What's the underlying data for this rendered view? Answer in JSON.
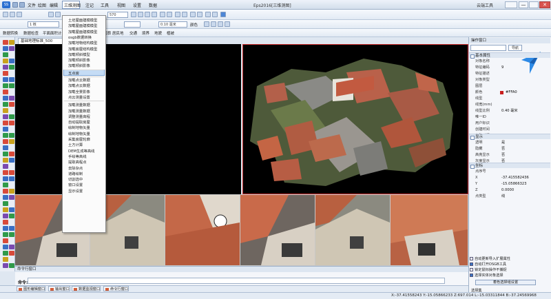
{
  "app": {
    "logo": "SS",
    "title": "Eps2016[三维测图]"
  },
  "menu": [
    "文件",
    "绘图",
    "编辑",
    "三维测图",
    "注记",
    "工具",
    "视图",
    "设置",
    "数据"
  ],
  "window_controls": {
    "help": "帮助",
    "cloud": "云端工具",
    "minimize": "—",
    "close": "✕"
  },
  "toolbar": {
    "layer_value": "1 核",
    "scale_value": "570",
    "line_width": "0.10 毫米",
    "dash_label": "颜色"
  },
  "tabs_row": [
    "数据转换",
    "数据检查",
    "平面面积计算",
    "图廓",
    "居民地",
    "交通",
    "境界",
    "地貌",
    "植被"
  ],
  "document_tab": {
    "label": "基础地理标准_500",
    "close": "×"
  },
  "dropdown": {
    "group1": [
      "土坯屋面建模模型",
      "加载屋面建模模型",
      "加载屋面建模模型",
      "osgb数据转换",
      "加载地物结构模型",
      "加载房屋结构模型",
      "加载倾斜模型",
      "加载倾斜影像",
      "加载倾斜影像"
    ],
    "highlight": "五点房",
    "group2": [
      "加载点云数据",
      "加载点云数据",
      "加载全景影像",
      "点云测量设置"
    ],
    "group3": [
      "加载测量数据",
      "加载测量数据",
      "调整测量高程",
      "自动提取房屋",
      "绘制地物矢量",
      "绘制地物矢量",
      "采集房屋轮廓",
      "土方计算",
      "DEM生成等高线",
      "手绘等高线",
      "提取高程点",
      "去除杂点",
      "道路绘制",
      "切割选中",
      "窗口设置",
      "显示设置"
    ]
  },
  "command": {
    "pane_title": "命令行窗口",
    "prompt": "命令:"
  },
  "bottom_tabs": [
    "图形编辑窗口",
    "输出窗口",
    "数据监视窗口",
    "命令行窗口"
  ],
  "status": {
    "coords": "X:-37.41558243 Y:-15.05866233 Z:697.014 L:-15.03311844 B:-37.24569968"
  },
  "properties": {
    "pane_title": "操作窗口",
    "dropdown": "",
    "extra_btn": "导航",
    "groups": {
      "basic": "基本属性",
      "display": "显示",
      "coords": "坐标"
    },
    "basic_rows": [
      [
        "对象名称",
        ""
      ],
      [
        "特征编码",
        "9"
      ],
      [
        "特征描述",
        ""
      ],
      [
        "对象类型",
        ""
      ],
      [
        "图层",
        ""
      ],
      [
        "颜色",
        "#FFA0"
      ],
      [
        "线型",
        ""
      ],
      [
        "线宽(mm)",
        ""
      ],
      [
        "线型比例",
        "0.40 毫米"
      ],
      [
        "唯一ID",
        ""
      ],
      [
        "用户标识",
        ""
      ],
      [
        "创建时间",
        ""
      ],
      [
        "修改时间",
        ""
      ]
    ],
    "display_rows": [
      [
        "透明",
        "是"
      ],
      [
        "隐藏",
        "否"
      ],
      [
        "高亮显示",
        "否"
      ],
      [
        "灰度显示",
        "否"
      ]
    ],
    "coord_rows": [
      [
        "点序号",
        ""
      ],
      [
        "X",
        "-37.415582436"
      ],
      [
        "Y",
        "-15.05866323"
      ],
      [
        "Z",
        "0.0000"
      ],
      [
        "点类型",
        "线"
      ]
    ],
    "checkboxes": [
      {
        "label": "自动更新导入扩展属性",
        "checked": false
      },
      {
        "label": "自动打开OSGB工具",
        "checked": true
      },
      {
        "label": "锁定鼠标操作不捕捉",
        "checked": false
      },
      {
        "label": "选择实体对象选择",
        "checked": true
      }
    ],
    "lock_btn": "着色选择组设置",
    "footer": "选择集"
  },
  "colors": {
    "accent": "#3a74c4",
    "highlight_border": "#d03030",
    "swatch_red": "#c81e1e"
  }
}
